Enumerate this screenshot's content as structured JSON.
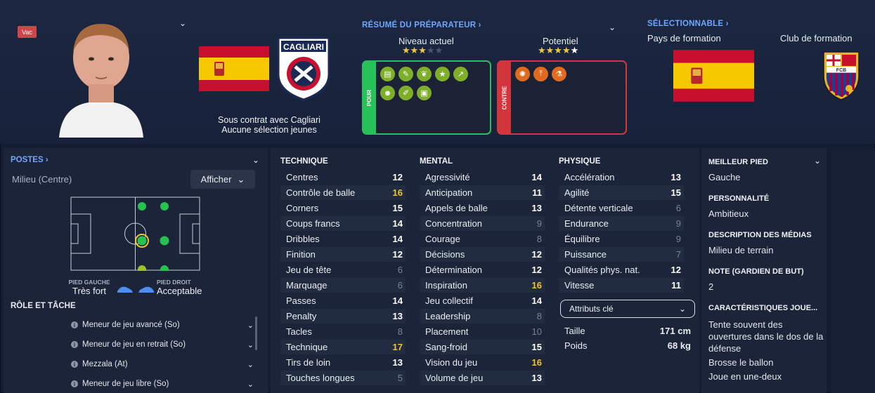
{
  "header": {
    "vac_badge": "Vac",
    "contract_line1": "Sous contrat avec Cagliari",
    "contract_line2": "Aucune sélection jeunes",
    "club_badge_text": "CAGLIARI",
    "coach_report": {
      "title": "RÉSUMÉ DU PRÉPARATEUR",
      "current_label": "Niveau actuel",
      "potential_label": "Potentiel",
      "current_stars": 3,
      "potential_stars": 4.5,
      "pour_label": "POUR",
      "contre_label": "CONTRE"
    },
    "selectable": {
      "title": "SÉLECTIONNABLE",
      "country_label": "Pays de formation",
      "club_label": "Club de formation",
      "club_badge_text": "FCB"
    }
  },
  "positions": {
    "title": "POSTES",
    "position_text": "Milieu (Centre)",
    "show_button": "Afficher",
    "left_foot_label": "PIED GAUCHE",
    "left_foot_value": "Très fort",
    "right_foot_label": "PIED DROIT",
    "right_foot_value": "Acceptable",
    "role_title": "RÔLE ET TÂCHE",
    "roles": [
      "Meneur de jeu avancé (So)",
      "Meneur de jeu en retrait (So)",
      "Mezzala (At)",
      "Meneur de jeu libre (So)"
    ]
  },
  "attributes": {
    "technique": {
      "title": "TECHNIQUE",
      "rows": [
        {
          "name": "Centres",
          "value": "12"
        },
        {
          "name": "Contrôle de balle",
          "value": "16"
        },
        {
          "name": "Corners",
          "value": "15"
        },
        {
          "name": "Coups francs",
          "value": "14"
        },
        {
          "name": "Dribbles",
          "value": "14"
        },
        {
          "name": "Finition",
          "value": "12"
        },
        {
          "name": "Jeu de tête",
          "value": "6"
        },
        {
          "name": "Marquage",
          "value": "6"
        },
        {
          "name": "Passes",
          "value": "14"
        },
        {
          "name": "Penalty",
          "value": "13"
        },
        {
          "name": "Tacles",
          "value": "8"
        },
        {
          "name": "Technique",
          "value": "17"
        },
        {
          "name": "Tirs de loin",
          "value": "13"
        },
        {
          "name": "Touches longues",
          "value": "5"
        }
      ]
    },
    "mental": {
      "title": "MENTAL",
      "rows": [
        {
          "name": "Agressivité",
          "value": "14"
        },
        {
          "name": "Anticipation",
          "value": "11"
        },
        {
          "name": "Appels de balle",
          "value": "13"
        },
        {
          "name": "Concentration",
          "value": "9"
        },
        {
          "name": "Courage",
          "value": "8"
        },
        {
          "name": "Décisions",
          "value": "12"
        },
        {
          "name": "Détermination",
          "value": "12"
        },
        {
          "name": "Inspiration",
          "value": "16"
        },
        {
          "name": "Jeu collectif",
          "value": "14"
        },
        {
          "name": "Leadership",
          "value": "8"
        },
        {
          "name": "Placement",
          "value": "10"
        },
        {
          "name": "Sang-froid",
          "value": "15"
        },
        {
          "name": "Vision du jeu",
          "value": "16"
        },
        {
          "name": "Volume de jeu",
          "value": "13"
        }
      ]
    },
    "physique": {
      "title": "PHYSIQUE",
      "rows": [
        {
          "name": "Accélération",
          "value": "13"
        },
        {
          "name": "Agilité",
          "value": "15"
        },
        {
          "name": "Détente verticale",
          "value": "6"
        },
        {
          "name": "Endurance",
          "value": "9"
        },
        {
          "name": "Équilibre",
          "value": "9"
        },
        {
          "name": "Puissance",
          "value": "7"
        },
        {
          "name": "Qualités phys. nat.",
          "value": "12"
        },
        {
          "name": "Vitesse",
          "value": "11"
        }
      ],
      "key_attrs_button": "Attributs clé",
      "height_label": "Taille",
      "height_value": "171 cm",
      "weight_label": "Poids",
      "weight_value": "68 kg"
    }
  },
  "info": {
    "best_foot_title": "MEILLEUR PIED",
    "best_foot_value": "Gauche",
    "personality_title": "PERSONNALITÉ",
    "personality_value": "Ambitieux",
    "media_title": "DESCRIPTION DES MÉDIAS",
    "media_value": "Milieu de terrain",
    "gk_title": "NOTE (GARDIEN DE BUT)",
    "gk_value": "2",
    "traits_title": "CARACTÉRISTIQUES JOUE...",
    "traits": [
      "Tente souvent des ouvertures dans le dos de la défense",
      "Brosse le ballon",
      "Joue en une-deux"
    ]
  },
  "colors": {
    "accent_link": "#6fa7ff",
    "pour_green": "#27c15a",
    "contre_red": "#d3353d",
    "highlight_value": "#f2c230"
  }
}
